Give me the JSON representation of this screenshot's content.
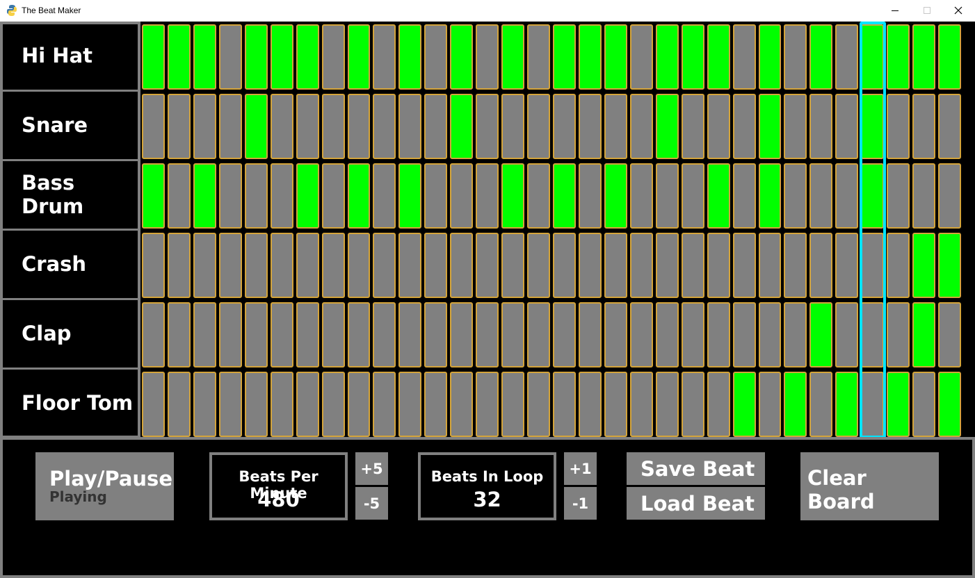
{
  "window": {
    "title": "The Beat Maker",
    "icon": "python-icon",
    "controls": [
      "minimize-icon",
      "maximize-icon",
      "close-icon"
    ]
  },
  "instruments": [
    {
      "name": "Hi Hat"
    },
    {
      "name": "Snare"
    },
    {
      "name": "Bass Drum"
    },
    {
      "name": "Crash"
    },
    {
      "name": "Clap"
    },
    {
      "name": "Floor Tom"
    }
  ],
  "grid": {
    "beats": 32,
    "active_beat": 28,
    "rows": [
      [
        1,
        1,
        1,
        0,
        1,
        1,
        1,
        0,
        1,
        0,
        1,
        0,
        1,
        0,
        1,
        0,
        1,
        1,
        1,
        0,
        1,
        1,
        1,
        0,
        1,
        0,
        1,
        0,
        1,
        1,
        1,
        1
      ],
      [
        0,
        0,
        0,
        0,
        1,
        0,
        0,
        0,
        0,
        0,
        0,
        0,
        1,
        0,
        0,
        0,
        0,
        0,
        0,
        0,
        1,
        0,
        0,
        0,
        1,
        0,
        0,
        0,
        1,
        0,
        0,
        0
      ],
      [
        1,
        0,
        1,
        0,
        0,
        0,
        1,
        0,
        1,
        0,
        1,
        0,
        0,
        0,
        1,
        0,
        1,
        0,
        1,
        0,
        0,
        0,
        1,
        0,
        1,
        0,
        0,
        0,
        1,
        0,
        0,
        0
      ],
      [
        0,
        0,
        0,
        0,
        0,
        0,
        0,
        0,
        0,
        0,
        0,
        0,
        0,
        0,
        0,
        0,
        0,
        0,
        0,
        0,
        0,
        0,
        0,
        0,
        0,
        0,
        0,
        0,
        0,
        0,
        1,
        1
      ],
      [
        0,
        0,
        0,
        0,
        0,
        0,
        0,
        0,
        0,
        0,
        0,
        0,
        0,
        0,
        0,
        0,
        0,
        0,
        0,
        0,
        0,
        0,
        0,
        0,
        0,
        0,
        1,
        0,
        0,
        0,
        1,
        0
      ],
      [
        0,
        0,
        0,
        0,
        0,
        0,
        0,
        0,
        0,
        0,
        0,
        0,
        0,
        0,
        0,
        0,
        0,
        0,
        0,
        0,
        0,
        0,
        0,
        1,
        0,
        1,
        0,
        1,
        0,
        1,
        0,
        1
      ]
    ],
    "colors": {
      "on": "#00ff00",
      "off": "#808080",
      "cell_border": "#d4a43a",
      "playhead": "#00e5ff"
    }
  },
  "controls": {
    "play_pause": {
      "label": "Play/Pause",
      "status": "Playing"
    },
    "bpm": {
      "title": "Beats Per Minute",
      "value": "480",
      "up": "+5",
      "down": "-5"
    },
    "loop": {
      "title": "Beats In Loop",
      "value": "32",
      "up": "+1",
      "down": "-1"
    },
    "save": "Save Beat",
    "load": "Load Beat",
    "clear": "Clear Board"
  }
}
